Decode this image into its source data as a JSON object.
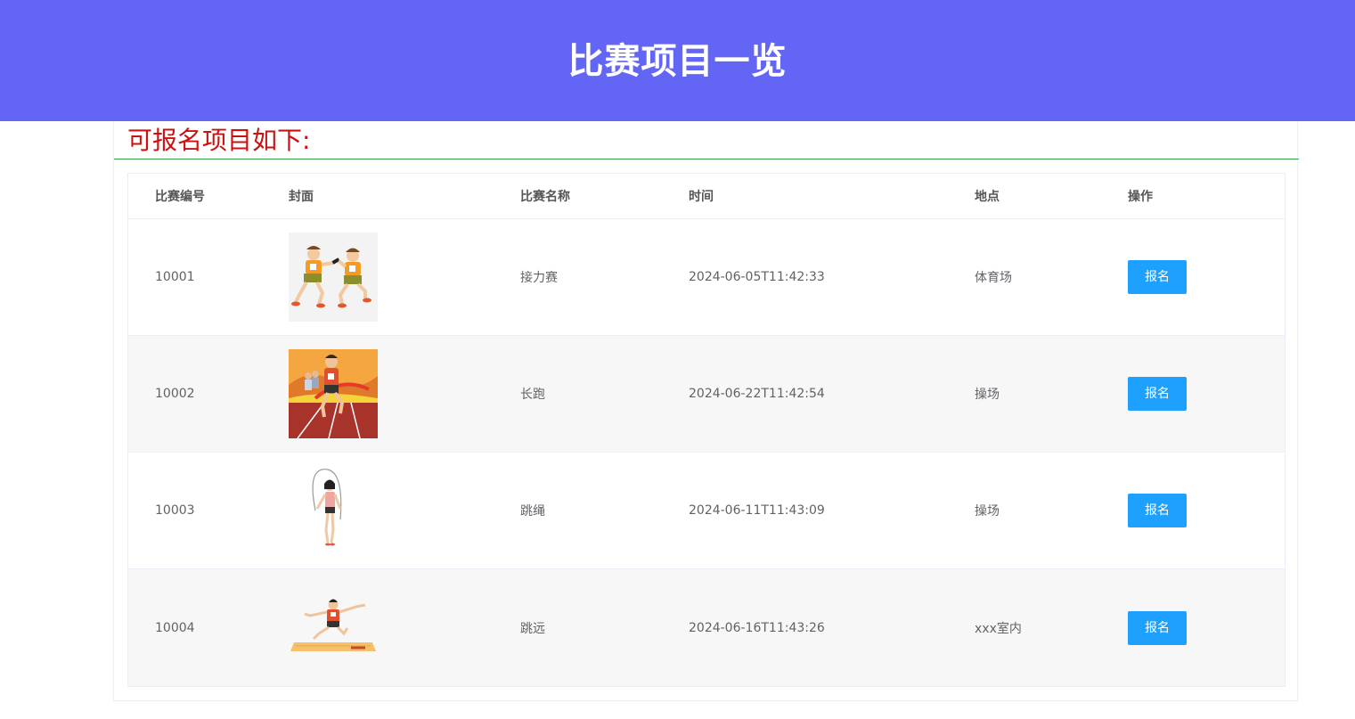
{
  "header": {
    "title": "比赛项目一览"
  },
  "section": {
    "title": "可报名项目如下:"
  },
  "table": {
    "columns": {
      "id": "比赛编号",
      "cover": "封面",
      "name": "比赛名称",
      "time": "时间",
      "place": "地点",
      "op": "操作"
    },
    "rows": [
      {
        "id": "10001",
        "cover_icon": "relay-race-image",
        "name": "接力赛",
        "time": "2024-06-05T11:42:33",
        "place": "体育场",
        "action": "报名"
      },
      {
        "id": "10002",
        "cover_icon": "long-distance-run-image",
        "name": "长跑",
        "time": "2024-06-22T11:42:54",
        "place": "操场",
        "action": "报名"
      },
      {
        "id": "10003",
        "cover_icon": "jump-rope-image",
        "name": "跳绳",
        "time": "2024-06-11T11:43:09",
        "place": "操场",
        "action": "报名"
      },
      {
        "id": "10004",
        "cover_icon": "long-jump-image",
        "name": "跳远",
        "time": "2024-06-16T11:43:26",
        "place": "xxx室内",
        "action": "报名"
      }
    ]
  },
  "colors": {
    "header_bg": "#6366f5",
    "section_title": "#cc1111",
    "divider": "#3aa24b",
    "button": "#1ea0ff",
    "stripe": "#f7f7f7"
  }
}
